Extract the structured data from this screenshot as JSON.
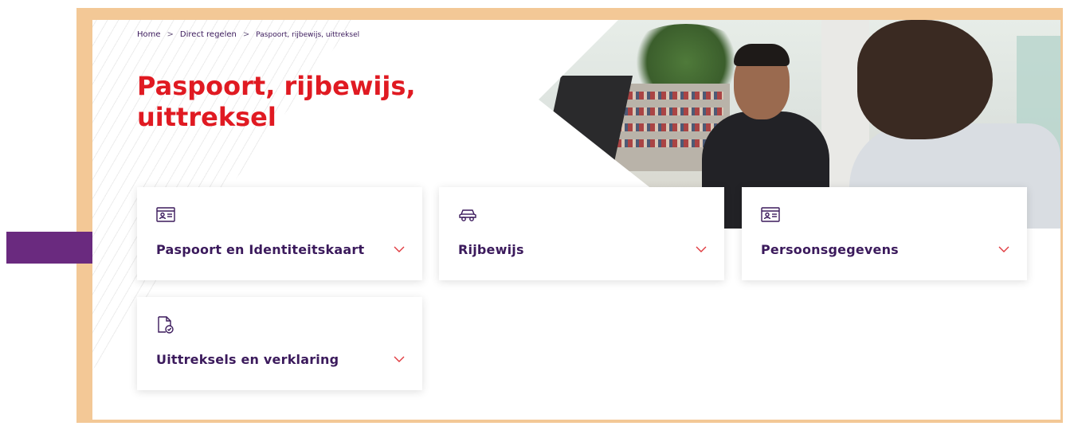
{
  "breadcrumb": {
    "home": "Home",
    "direct": "Direct regelen",
    "current": "Paspoort, rijbewijs, uittreksel",
    "separator": ">"
  },
  "page": {
    "title_line1": "Paspoort, rijbewijs,",
    "title_line2": "uittreksel"
  },
  "cards": [
    {
      "label": "Paspoort en Identiteitskaart",
      "icon": "id-card-icon"
    },
    {
      "label": "Rijbewijs",
      "icon": "car-icon"
    },
    {
      "label": "Persoonsgegevens",
      "icon": "id-card-icon"
    },
    {
      "label": "Uittreksels en verklaring",
      "icon": "document-check-icon"
    }
  ],
  "colors": {
    "title": "#e01a22",
    "text": "#3b1a5c",
    "chevron": "#e0393e",
    "frame": "#f3c896",
    "arrow": "#6a2a7f"
  }
}
